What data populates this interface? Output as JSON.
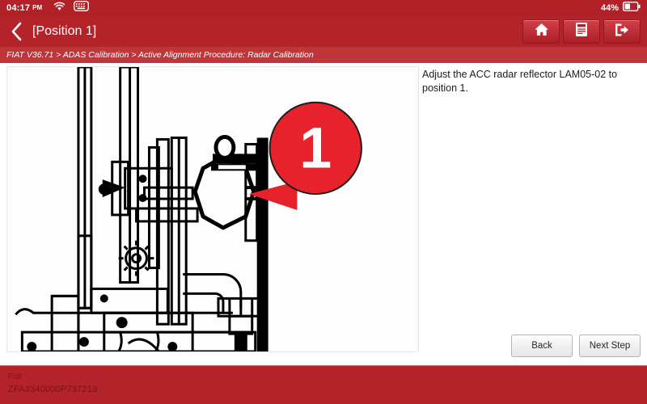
{
  "statusbar": {
    "time": "04:17",
    "ampm": "PM",
    "wifi_icon": "wifi-icon",
    "keyboard_icon": "keyboard-icon",
    "battery_percent": "44%",
    "battery_icon": "battery-icon"
  },
  "titlebar": {
    "back_icon": "back-chevron-icon",
    "title": "[Position 1]",
    "actions": [
      {
        "name": "home-button",
        "icon": "home-icon"
      },
      {
        "name": "report-button",
        "icon": "document-icon"
      },
      {
        "name": "exit-button",
        "icon": "exit-icon"
      }
    ]
  },
  "breadcrumb": {
    "text": "FIAT V36.71 > ADAS Calibration > Active Alignment Procedure: Radar Calibration"
  },
  "main": {
    "instruction": "Adjust the ACC radar reflector LAM05-02 to position 1.",
    "callout_number": "1",
    "diagram_alt": "ADAS radar calibration rig line drawing with octagonal reflector"
  },
  "buttons": {
    "back": "Back",
    "next": "Next Step"
  },
  "vehicle": {
    "make": "Fiat",
    "vin": "ZFA3340000P737213"
  },
  "colors": {
    "brand_red": "#b42329",
    "status_red": "#b02128",
    "breadcrumb_red": "#c0353a",
    "callout_red": "#e8222c",
    "footer_text": "#7d1116"
  }
}
